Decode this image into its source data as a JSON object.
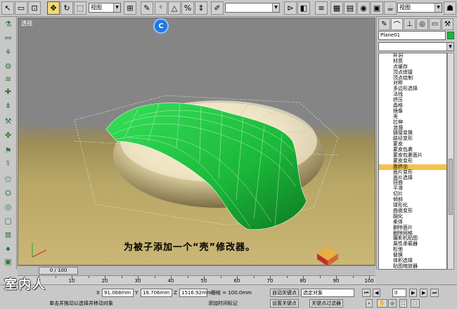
{
  "toolbar": {
    "view_select": "视图",
    "view_select_2": "视图"
  },
  "viewport": {
    "label": "透视",
    "caption": "为被子添加一个“壳”修改器。",
    "badge_letter": "C"
  },
  "command_panel": {
    "object_name": "Plane01",
    "object_color": "#1bb83a",
    "selected_index": 20,
    "modifiers": [
      "补洞",
      "材质",
      "点缓存",
      "顶点焊接",
      "顶点绘制",
      "对称",
      "多边形选择",
      "法线",
      "挤压",
      "晶格",
      "镜像",
      "壳",
      "拉伸",
      "涟漪",
      "链接变换",
      "路径变形",
      "蒙皮",
      "蒙皮包裹",
      "蒙皮包裹面片",
      "蒙皮变形",
      "面挤出",
      "面片变形",
      "面片选择",
      "扭曲",
      "平滑",
      "切片",
      "倾斜",
      "球形化",
      "曲面变形",
      "融化",
      "柔体",
      "删除面片",
      "删除网格",
      "摄影机贴图",
      "属性承载器",
      "松弛",
      "替换",
      "体积选择",
      "贴图缩放器"
    ]
  },
  "timeline": {
    "frame_display": "0 / 100"
  },
  "ruler": {
    "labels": [
      "10",
      "20",
      "30",
      "40",
      "50",
      "60",
      "70",
      "80",
      "90",
      "100"
    ]
  },
  "status": {
    "x_label": "X",
    "x_value": "91.068mm",
    "y_label": "Y",
    "y_value": "18.706mm",
    "z_label": "Z",
    "z_value": "1516.92mm",
    "grid_label": "栅格 = 100.0mm",
    "auto_key": "自动关键点",
    "selected_object": "选定对象",
    "set_key": "设置关键点",
    "key_filter": "关键点过滤器",
    "prompt": "单击并拖动以选择并移动对象",
    "add_time_tag": "添加时间标记",
    "frame_value": "0",
    "watermark": "室内人"
  },
  "colors": {
    "selection_highlight": "#f2c24a",
    "cloth_green": "#1fc23c",
    "viewport_floor": "#b8a666"
  }
}
